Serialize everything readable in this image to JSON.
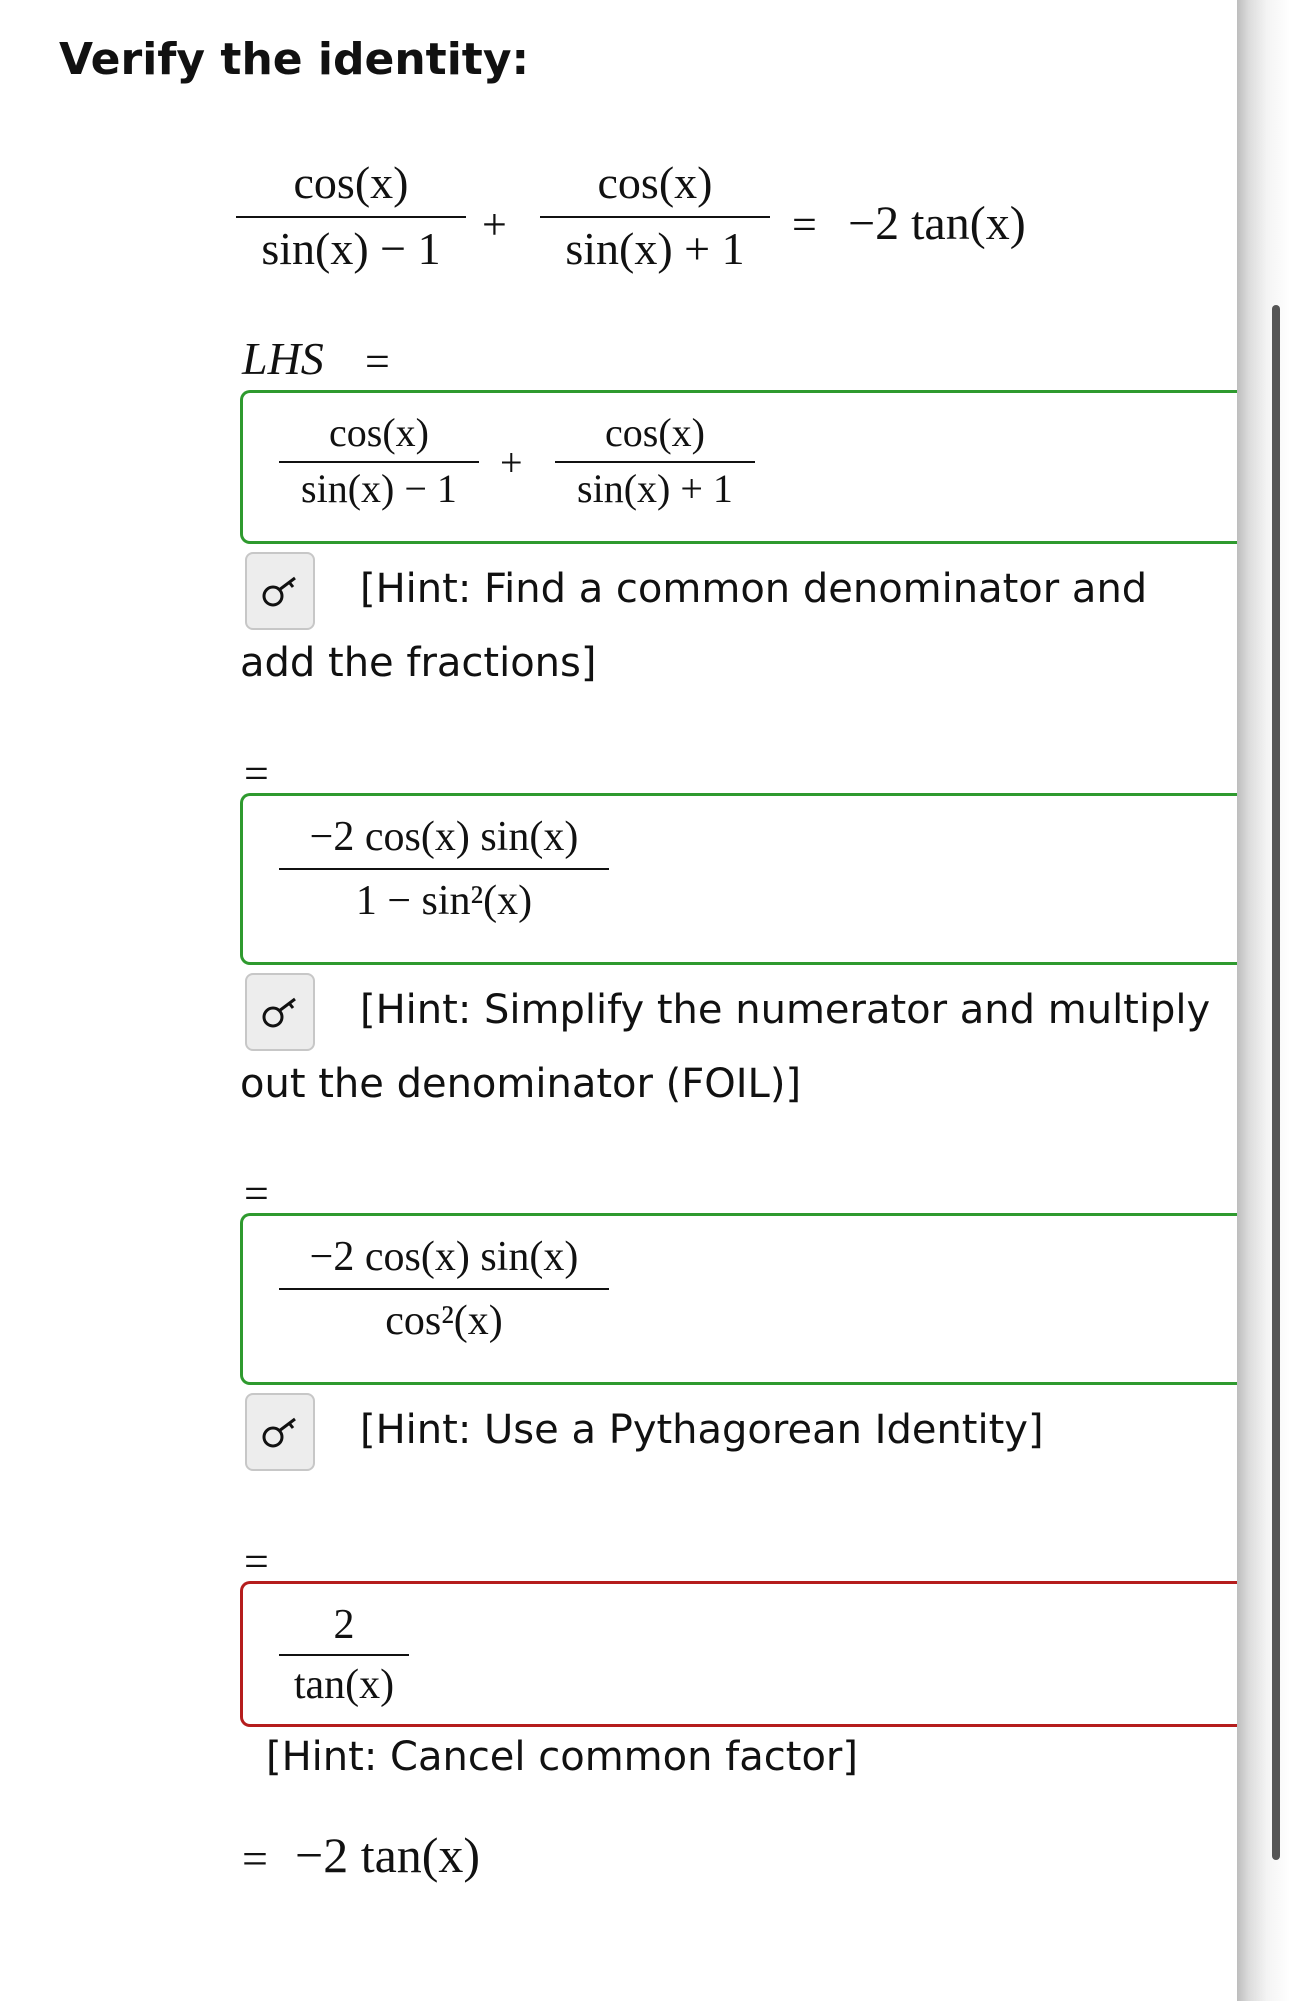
{
  "title": "Verify the identity:",
  "identity": {
    "term1_num": "cos(x)",
    "term1_den": "sin(x) − 1",
    "plus": "+",
    "term2_num": "cos(x)",
    "term2_den": "sin(x) + 1",
    "equals": "=",
    "rhs": "−2 tan(x)"
  },
  "lhs_label": "LHS",
  "lhs_equals": "=",
  "steps": [
    {
      "expr": {
        "t1_num": "cos(x)",
        "t1_den": "sin(x) − 1",
        "plus": "+",
        "t2_num": "cos(x)",
        "t2_den": "sin(x) + 1"
      },
      "status": "correct",
      "hint": "[Hint: Find a common denominator and add the fractions]",
      "hint_icon": "key-icon"
    },
    {
      "equals": "=",
      "expr": {
        "num": "−2 cos(x) sin(x)",
        "den": "1 − sin²(x)"
      },
      "status": "correct",
      "hint": "[Hint: Simplify the numerator and multiply out the denominator (FOIL)]",
      "hint_icon": "key-icon"
    },
    {
      "equals": "=",
      "expr": {
        "num": "−2 cos(x) sin(x)",
        "den": "cos²(x)"
      },
      "status": "correct",
      "hint": "[Hint: Use a Pythagorean Identity]",
      "hint_icon": "key-icon"
    },
    {
      "equals": "=",
      "expr": {
        "num": "2",
        "den": "tan(x)"
      },
      "status": "incorrect",
      "hint": "[Hint: Cancel common factor]"
    }
  ],
  "final": {
    "equals": "=",
    "value": "−2 tan(x)"
  },
  "colors": {
    "correct_border": "#2e9a2e",
    "incorrect_border": "#b51d1d",
    "hint_button_bg": "#ededed"
  }
}
